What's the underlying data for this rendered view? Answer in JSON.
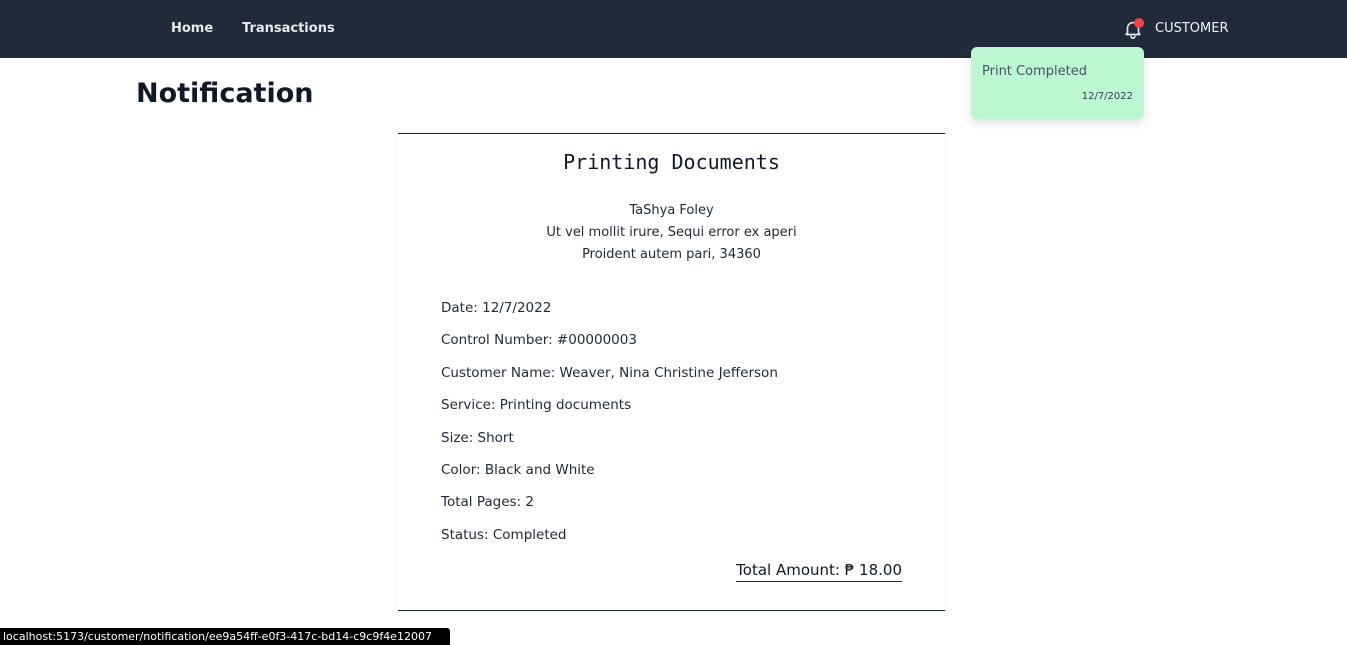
{
  "nav": {
    "home": "Home",
    "transactions": "Transactions",
    "user": "CUSTOMER",
    "bell_icon": "bell-icon",
    "badge_color": "#ef4444"
  },
  "page": {
    "title": "Notification"
  },
  "toast": {
    "title": "Print Completed",
    "date": "12/7/2022",
    "bg_color": "#bbf7d0"
  },
  "receipt": {
    "title": "Printing Documents",
    "shop_name": "TaShya Foley",
    "shop_address1": "Ut vel mollit irure, Sequi error ex aperi",
    "shop_address2": "Proident autem pari, 34360",
    "date": "Date: 12/7/2022",
    "control_number": "Control Number: #00000003",
    "customer_name": "Customer Name: Weaver, Nina Christine Jefferson",
    "service": "Service: Printing documents",
    "size": "Size: Short",
    "color": "Color: Black and White",
    "total_pages": "Total Pages: 2",
    "status": "Status: Completed",
    "total_amount": "Total Amount: ₱ 18.00"
  },
  "statusbar": {
    "url": "localhost:5173/customer/notification/ee9a54ff-e0f3-417c-bd14-c9c9f4e12007"
  }
}
